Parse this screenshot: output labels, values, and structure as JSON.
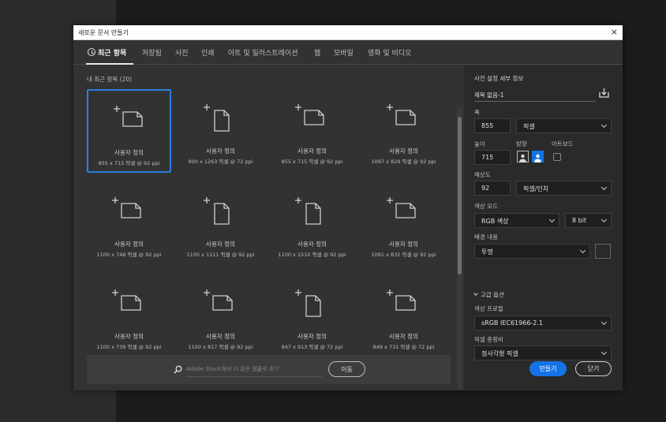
{
  "dialog": {
    "title": "새로운 문서 만들기",
    "close": "×"
  },
  "tabs": [
    {
      "label": "최근 항목",
      "active": true
    },
    {
      "label": "저장됨"
    },
    {
      "label": "사진"
    },
    {
      "label": "인쇄"
    },
    {
      "label": "아트 및 일러스트레이션"
    },
    {
      "label": "웹"
    },
    {
      "label": "모바일"
    },
    {
      "label": "영화 및 비디오"
    }
  ],
  "recent": {
    "label": "내 최근 항목 (20)",
    "items": [
      {
        "name": "사용자 정의",
        "dims": "855 x 715 픽셀 @ 92 ppi",
        "selected": true,
        "orientation": "landscape"
      },
      {
        "name": "사용자 정의",
        "dims": "900 x 1263 픽셀 @ 72 ppi",
        "orientation": "portrait"
      },
      {
        "name": "사용자 정의",
        "dims": "855 x 715 픽셀 @ 92 ppi",
        "orientation": "landscape"
      },
      {
        "name": "사용자 정의",
        "dims": "1097 x 829 픽셀 @ 92 ppi",
        "orientation": "landscape"
      },
      {
        "name": "사용자 정의",
        "dims": "1100 x 748 픽셀 @ 92 ppi",
        "orientation": "landscape"
      },
      {
        "name": "사용자 정의",
        "dims": "1100 x 1111 픽셀 @ 92 ppi",
        "orientation": "portrait"
      },
      {
        "name": "사용자 정의",
        "dims": "1100 x 1510 픽셀 @ 92 ppi",
        "orientation": "portrait"
      },
      {
        "name": "사용자 정의",
        "dims": "1091 x 832 픽셀 @ 92 ppi",
        "orientation": "landscape"
      },
      {
        "name": "사용자 정의",
        "dims": "1100 x 739 픽셀 @ 92 ppi",
        "orientation": "landscape"
      },
      {
        "name": "사용자 정의",
        "dims": "1100 x 817 픽셀 @ 92 ppi",
        "orientation": "landscape"
      },
      {
        "name": "사용자 정의",
        "dims": "847 x 913 픽셀 @ 72 ppi",
        "orientation": "portrait"
      },
      {
        "name": "사용자 정의",
        "dims": "849 x 731 픽셀 @ 72 ppi",
        "orientation": "landscape"
      }
    ]
  },
  "search": {
    "placeholder": "Adobe Stock에서 더 많은 템플릿 찾기",
    "button": "이동"
  },
  "details": {
    "title": "사전 설정 세부 정보",
    "doc_name": "제목 없음-1",
    "width_label": "폭",
    "width_value": "855",
    "width_unit": "픽셀",
    "height_label": "높이",
    "height_value": "715",
    "orientation_label": "방향",
    "artboard_label": "아트보드",
    "resolution_label": "해상도",
    "resolution_value": "92",
    "resolution_unit": "픽셀/인치",
    "color_mode_label": "색상 모드",
    "color_mode": "RGB 색상",
    "bit_depth": "8 bit",
    "bg_label": "배경 내용",
    "bg_value": "투명",
    "advanced_label": "고급 옵션",
    "color_profile_label": "색상 프로필",
    "color_profile": "sRGB IEC61966-2.1",
    "pixel_aspect_label": "픽셀 종횡비",
    "pixel_aspect": "정사각형 픽셀"
  },
  "actions": {
    "create": "만들기",
    "cancel": "닫기"
  },
  "colors": {
    "accent": "#1473e6",
    "selection": "#2b7de3",
    "panel": "#323232",
    "side_panel": "#2a2a2a"
  }
}
